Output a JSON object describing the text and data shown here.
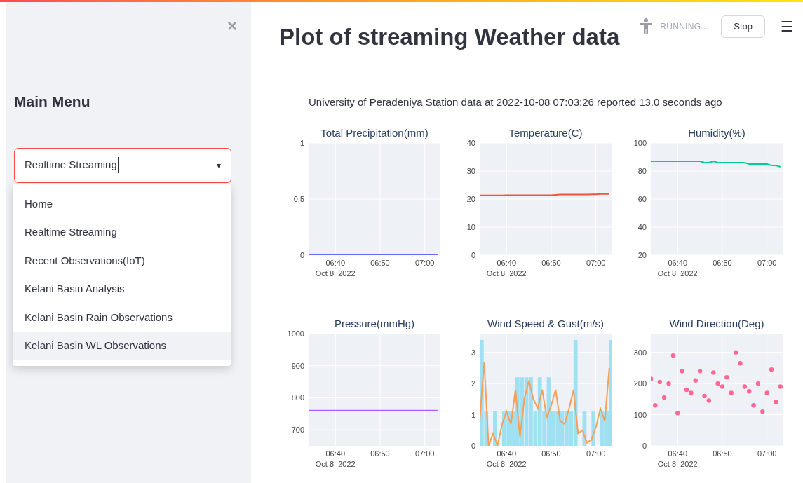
{
  "sidebar": {
    "close": "×",
    "heading": "Main Menu",
    "select": {
      "value": "Realtime Streaming",
      "caret": "▾"
    },
    "menu_items": [
      {
        "label": "Home",
        "highlighted": false
      },
      {
        "label": "Realtime Streaming",
        "highlighted": false
      },
      {
        "label": "Recent Observations(IoT)",
        "highlighted": false
      },
      {
        "label": "Kelani Basin Analysis",
        "highlighted": false
      },
      {
        "label": "Kelani Basin Rain Observations",
        "highlighted": false
      },
      {
        "label": "Kelani Basin WL Observations",
        "highlighted": true
      }
    ]
  },
  "header": {
    "status": "RUNNING...",
    "stop": "Stop",
    "menu": "☰"
  },
  "title": "Plot of streaming Weather data",
  "subtitle": "University of Peradeniya Station data at 2022-10-08 07:03:26 reported 13.0 seconds ago",
  "charts": [
    {
      "date": "Oct 8, 2022",
      "chart_data": {
        "type": "line",
        "title": "Total Precipitation(mm)",
        "grid": true,
        "categories": [
          null,
          null,
          null,
          null,
          null,
          null,
          "06:40",
          null,
          null,
          null,
          null,
          null,
          null,
          null,
          null,
          null,
          "06:50",
          null,
          null,
          null,
          null,
          null,
          null,
          null,
          null,
          null,
          "07:00",
          null,
          null,
          null
        ],
        "series": [
          {
            "color": "#636efa",
            "values": [
              0,
              0,
              0,
              0,
              0,
              0,
              0,
              0,
              0,
              0,
              0,
              0,
              0,
              0,
              0,
              0,
              0,
              0,
              0,
              0,
              0,
              0,
              0,
              0,
              0,
              0,
              0,
              0,
              0,
              0
            ]
          }
        ],
        "ylim": [
          0,
          1
        ],
        "yticks": [
          0,
          0.5,
          1
        ]
      }
    },
    {
      "date": "Oct 8, 2022",
      "chart_data": {
        "type": "line",
        "title": "Temperature(C)",
        "grid": true,
        "categories": [
          null,
          null,
          null,
          null,
          null,
          null,
          "06:40",
          null,
          null,
          null,
          null,
          null,
          null,
          null,
          null,
          null,
          "06:50",
          null,
          null,
          null,
          null,
          null,
          null,
          null,
          null,
          null,
          "07:00",
          null,
          null,
          null
        ],
        "series": [
          {
            "color": "#ef553b",
            "values": [
              21.3,
              21.3,
              21.3,
              21.3,
              21.3,
              21.3,
              21.4,
              21.4,
              21.4,
              21.4,
              21.4,
              21.4,
              21.4,
              21.4,
              21.4,
              21.4,
              21.4,
              21.5,
              21.6,
              21.6,
              21.6,
              21.6,
              21.6,
              21.6,
              21.6,
              21.7,
              21.7,
              21.8,
              21.8,
              21.8
            ]
          }
        ],
        "ylim": [
          0,
          40
        ],
        "yticks": [
          0,
          10,
          20,
          30,
          40
        ]
      }
    },
    {
      "date": "Oct 8, 2022",
      "chart_data": {
        "type": "line",
        "title": "Humidity(%)",
        "grid": true,
        "categories": [
          null,
          null,
          null,
          null,
          null,
          null,
          "06:40",
          null,
          null,
          null,
          null,
          null,
          null,
          null,
          null,
          null,
          "06:50",
          null,
          null,
          null,
          null,
          null,
          null,
          null,
          null,
          null,
          "07:00",
          null,
          null,
          null
        ],
        "series": [
          {
            "color": "#00cc96",
            "values": [
              87,
              87,
              87,
              87,
              87,
              87,
              87,
              87,
              87,
              87,
              87,
              87,
              86,
              86,
              87,
              86,
              86,
              86,
              86,
              86,
              86,
              86,
              85,
              85,
              85,
              85,
              85,
              84,
              84,
              83
            ]
          }
        ],
        "ylim": [
          20,
          100
        ],
        "yticks": [
          20,
          40,
          60,
          80,
          100
        ]
      }
    },
    {
      "date": "Oct 8, 2022",
      "chart_data": {
        "type": "line",
        "title": "Pressure(mmHg)",
        "grid": true,
        "categories": [
          null,
          null,
          null,
          null,
          null,
          null,
          "06:40",
          null,
          null,
          null,
          null,
          null,
          null,
          null,
          null,
          null,
          "06:50",
          null,
          null,
          null,
          null,
          null,
          null,
          null,
          null,
          null,
          "07:00",
          null,
          null,
          null
        ],
        "series": [
          {
            "color": "#ab63fa",
            "values": [
              760,
              760,
              760,
              760,
              760,
              760,
              760,
              760,
              760,
              760,
              760,
              760,
              760,
              760,
              760,
              760,
              760,
              760,
              760,
              760,
              760,
              760,
              760,
              760,
              760,
              760,
              760,
              760,
              760,
              760
            ]
          }
        ],
        "ylim": [
          650,
          1000
        ],
        "yticks": [
          700,
          800,
          900,
          1000
        ]
      }
    },
    {
      "date": "Oct 8, 2022",
      "chart_data": {
        "type": "bar",
        "title": "Wind Speed & Gust(m/s)",
        "grid": true,
        "categories": [
          null,
          null,
          null,
          null,
          null,
          null,
          "06:40",
          null,
          null,
          null,
          null,
          null,
          null,
          null,
          null,
          null,
          "06:50",
          null,
          null,
          null,
          null,
          null,
          null,
          null,
          null,
          null,
          "07:00",
          null,
          null,
          null
        ],
        "series": [
          {
            "color": "#9fe0f2",
            "values": [
              3.4,
              1.1,
              0,
              1.1,
              0,
              1.1,
              1.1,
              1.1,
              2.2,
              2.2,
              2.2,
              2.2,
              1.1,
              2.2,
              1.1,
              2.2,
              1.1,
              1.1,
              1.1,
              1.1,
              1.1,
              3.4,
              0,
              1.1,
              0,
              1.1,
              0,
              1.1,
              1.1,
              3.4
            ]
          },
          {
            "type": "line",
            "color": "#f4a05a",
            "values": [
              0.8,
              2.7,
              0,
              0.4,
              0,
              0.7,
              1.1,
              0.7,
              1.8,
              0.3,
              1.5,
              2.1,
              1.5,
              1.2,
              1.8,
              0.9,
              1.3,
              1.8,
              0.8,
              0.7,
              1.2,
              1.8,
              0.4,
              0.5,
              0.1,
              0.2,
              0.6,
              1.2,
              0.8,
              2.5
            ]
          }
        ],
        "ylim": [
          0,
          3.6
        ],
        "yticks": [
          0,
          1,
          2,
          3
        ]
      }
    },
    {
      "date": "Oct 8, 2022",
      "chart_data": {
        "type": "scatter",
        "title": "Wind Direction(Deg)",
        "grid": true,
        "categories": [
          null,
          null,
          null,
          null,
          null,
          null,
          "06:40",
          null,
          null,
          null,
          null,
          null,
          null,
          null,
          null,
          null,
          "06:50",
          null,
          null,
          null,
          null,
          null,
          null,
          null,
          null,
          null,
          "07:00",
          null,
          null,
          null
        ],
        "series": [
          {
            "color": "#ff6692",
            "values": [
              215,
              130,
              205,
              155,
              200,
              290,
              105,
              240,
              180,
              170,
              210,
              240,
              160,
              145,
              235,
              200,
              190,
              220,
              170,
              300,
              265,
              190,
              175,
              130,
              200,
              110,
              170,
              245,
              140,
              190
            ]
          }
        ],
        "ylim": [
          0,
          360
        ],
        "yticks": [
          0,
          100,
          200,
          300
        ]
      }
    }
  ]
}
